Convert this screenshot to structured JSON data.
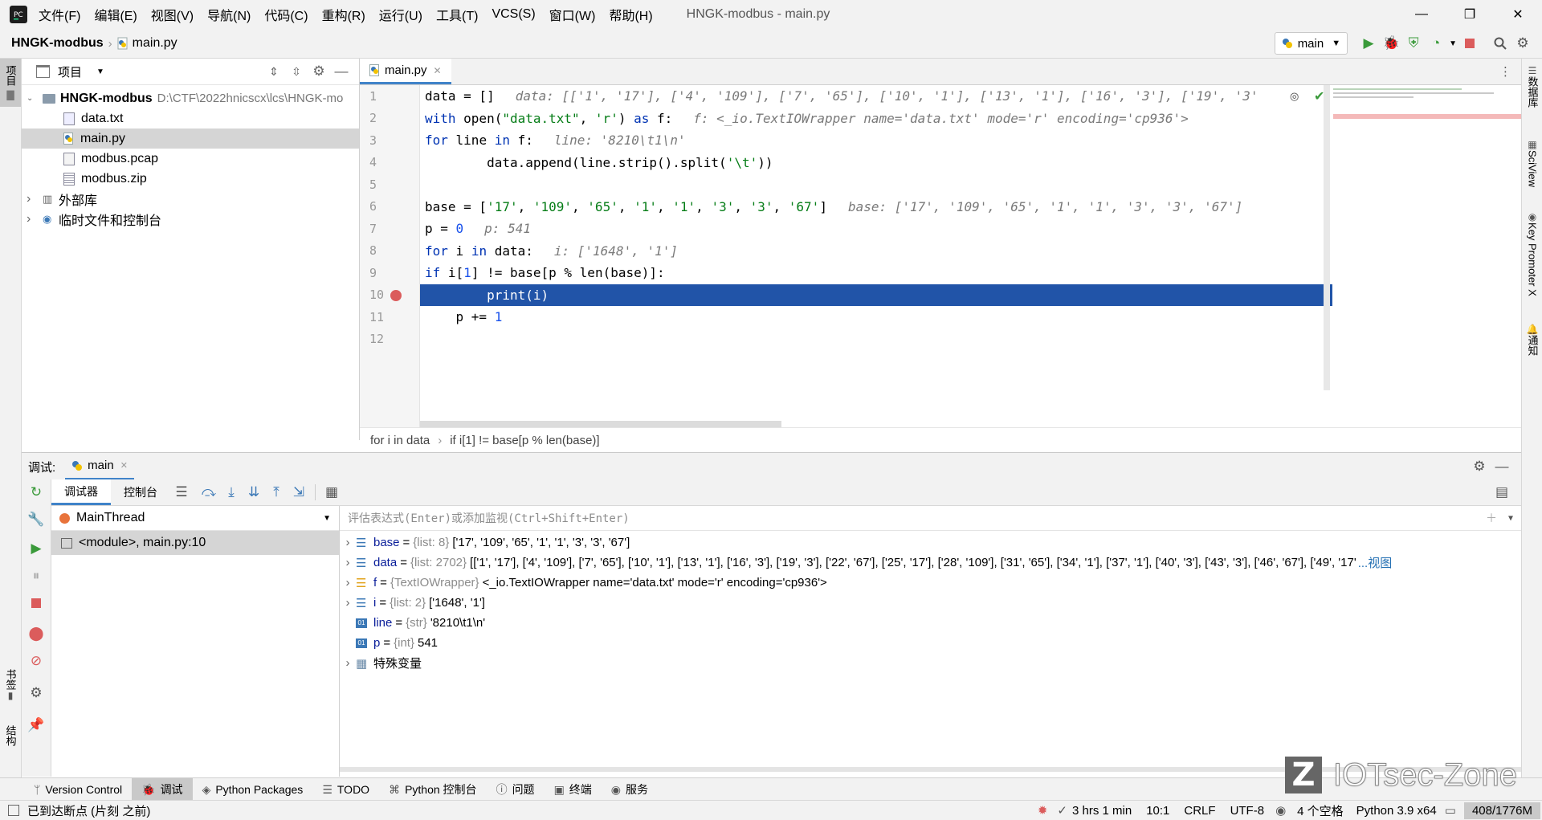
{
  "titlebar": {
    "menu": [
      "文件(F)",
      "编辑(E)",
      "视图(V)",
      "导航(N)",
      "代码(C)",
      "重构(R)",
      "运行(U)",
      "工具(T)",
      "VCS(S)",
      "窗口(W)",
      "帮助(H)"
    ],
    "window_title": "HNGK-modbus - main.py",
    "minimize": "—",
    "maximize": "❐",
    "close": "✕"
  },
  "nav": {
    "project": "HNGK-modbus",
    "file": "main.py",
    "run_config": "main"
  },
  "project_panel": {
    "title": "项目",
    "root_name": "HNGK-modbus",
    "root_path": "D:\\CTF\\2022hnicscx\\lcs\\HNGK-mo",
    "files": [
      "data.txt",
      "main.py",
      "modbus.pcap",
      "modbus.zip"
    ],
    "external_libs": "外部库",
    "scratches": "临时文件和控制台"
  },
  "left_strip": {
    "project": "项目",
    "bookmarks": "书签",
    "structure": "结构"
  },
  "right_strip": {
    "database": "数据库",
    "sciview": "SciView",
    "key_promoter": "Key Promoter X",
    "notifications": "通知"
  },
  "editor": {
    "tab": "main.py",
    "line_numbers": [
      "1",
      "2",
      "3",
      "4",
      "5",
      "6",
      "7",
      "8",
      "9",
      "10",
      "11",
      "12"
    ],
    "current_line": 10,
    "hints": {
      "l1": "data: [['1', '17'], ['4', '109'], ['7', '65'], ['10', '1'], ['13', '1'], ['16', '3'], ['19', '3'",
      "l2": "f: <_io.TextIOWrapper name='data.txt' mode='r' encoding='cp936'>",
      "l3": "line: '8210\\t1\\n'",
      "l6": "base: ['17', '109', '65', '1', '1', '3', '3', '67']",
      "l7": "p: 541",
      "l8": "i: ['1648', '1']"
    },
    "breadcrumb": [
      "for i in data",
      "if i[1] != base[p % len(base)]"
    ]
  },
  "debug": {
    "label": "调试:",
    "session": "main",
    "tabs": [
      "调试器",
      "控制台"
    ],
    "thread": "MainThread",
    "frame": "<module>, main.py:10",
    "eval_placeholder": "评估表达式(Enter)或添加监视(Ctrl+Shift+Enter)",
    "variables": [
      {
        "name": "base",
        "type": "{list: 8}",
        "value": "['17', '109', '65', '1', '1', '3', '3', '67']",
        "expand": true,
        "icon": "list"
      },
      {
        "name": "data",
        "type": "{list: 2702}",
        "value": "[['1', '17'], ['4', '109'], ['7', '65'], ['10', '1'], ['13', '1'], ['16', '3'], ['19', '3'], ['22', '67'], ['25', '17'], ['28', '109'], ['31', '65'], ['34', '1'], ['37', '1'], ['40', '3'], ['43', '3'], ['46', '67'], ['49', '17'",
        "expand": true,
        "icon": "list",
        "link": "...视图"
      },
      {
        "name": "f",
        "type": "{TextIOWrapper}",
        "value": "<_io.TextIOWrapper name='data.txt' mode='r' encoding='cp936'>",
        "expand": true,
        "icon": "object"
      },
      {
        "name": "i",
        "type": "{list: 2}",
        "value": "['1648', '1']",
        "expand": true,
        "icon": "list"
      },
      {
        "name": "line",
        "type": "{str}",
        "value": "'8210\\t1\\n'",
        "expand": false,
        "icon": "primitive"
      },
      {
        "name": "p",
        "type": "{int}",
        "value": "541",
        "expand": false,
        "icon": "primitive"
      },
      {
        "name": "特殊变量",
        "type": "",
        "value": "",
        "expand": true,
        "icon": "special"
      }
    ]
  },
  "bottom_tabs": [
    "Version Control",
    "调试",
    "Python Packages",
    "TODO",
    "Python 控制台",
    "问题",
    "终端",
    "服务"
  ],
  "status": {
    "message": "已到达断点 (片刻 之前)",
    "time": "3 hrs 1 min",
    "position": "10:1",
    "line_sep": "CRLF",
    "encoding": "UTF-8",
    "indent": "4 个空格",
    "interpreter": "Python 3.9 x64",
    "memory": "408/1776M"
  },
  "watermark": "IOTsec-Zone",
  "colors": {
    "accent": "#2154a8",
    "keyword": "#0033b3",
    "string": "#067d17",
    "number": "#1750eb",
    "breakpoint": "#db5c5c",
    "run_green": "#3a9a3a"
  }
}
